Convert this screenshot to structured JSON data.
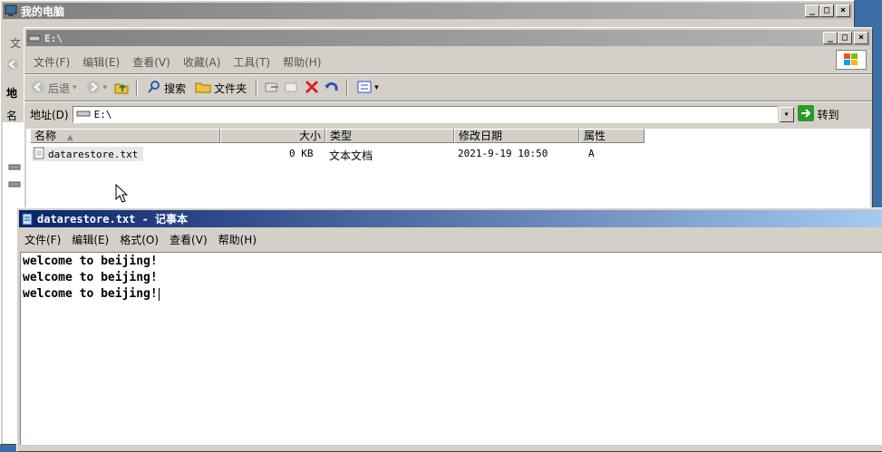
{
  "mycomputer": {
    "title": "我的电脑",
    "left_menu_fragment": "文",
    "left_addr_fragment": "地",
    "left_name_fragment": "名"
  },
  "explorer": {
    "title": "E:\\",
    "menu": [
      "文件(F)",
      "编辑(E)",
      "查看(V)",
      "收藏(A)",
      "工具(T)",
      "帮助(H)"
    ],
    "toolbar": {
      "back": "后退",
      "search": "搜索",
      "folders": "文件夹"
    },
    "address_label": "地址(D)",
    "address_value": "E:\\",
    "go_label": "转到",
    "columns": [
      "名称",
      "大小",
      "类型",
      "修改日期",
      "属性"
    ],
    "files": [
      {
        "name": "datarestore.txt",
        "size": "0 KB",
        "type": "文本文档",
        "modified": "2021-9-19 10:50",
        "attr": "A"
      }
    ]
  },
  "notepad": {
    "title": "datarestore.txt - 记事本",
    "menu": [
      "文件(F)",
      "编辑(E)",
      "格式(O)",
      "查看(V)",
      "帮助(H)"
    ],
    "lines": [
      "welcome to beijing!",
      "welcome to beijing!",
      "welcome to beijing!"
    ]
  },
  "colors": {
    "active_title": "#0a246a",
    "inactive_title": "#808080",
    "face": "#d4d0c8",
    "delete_red": "#e02020"
  }
}
